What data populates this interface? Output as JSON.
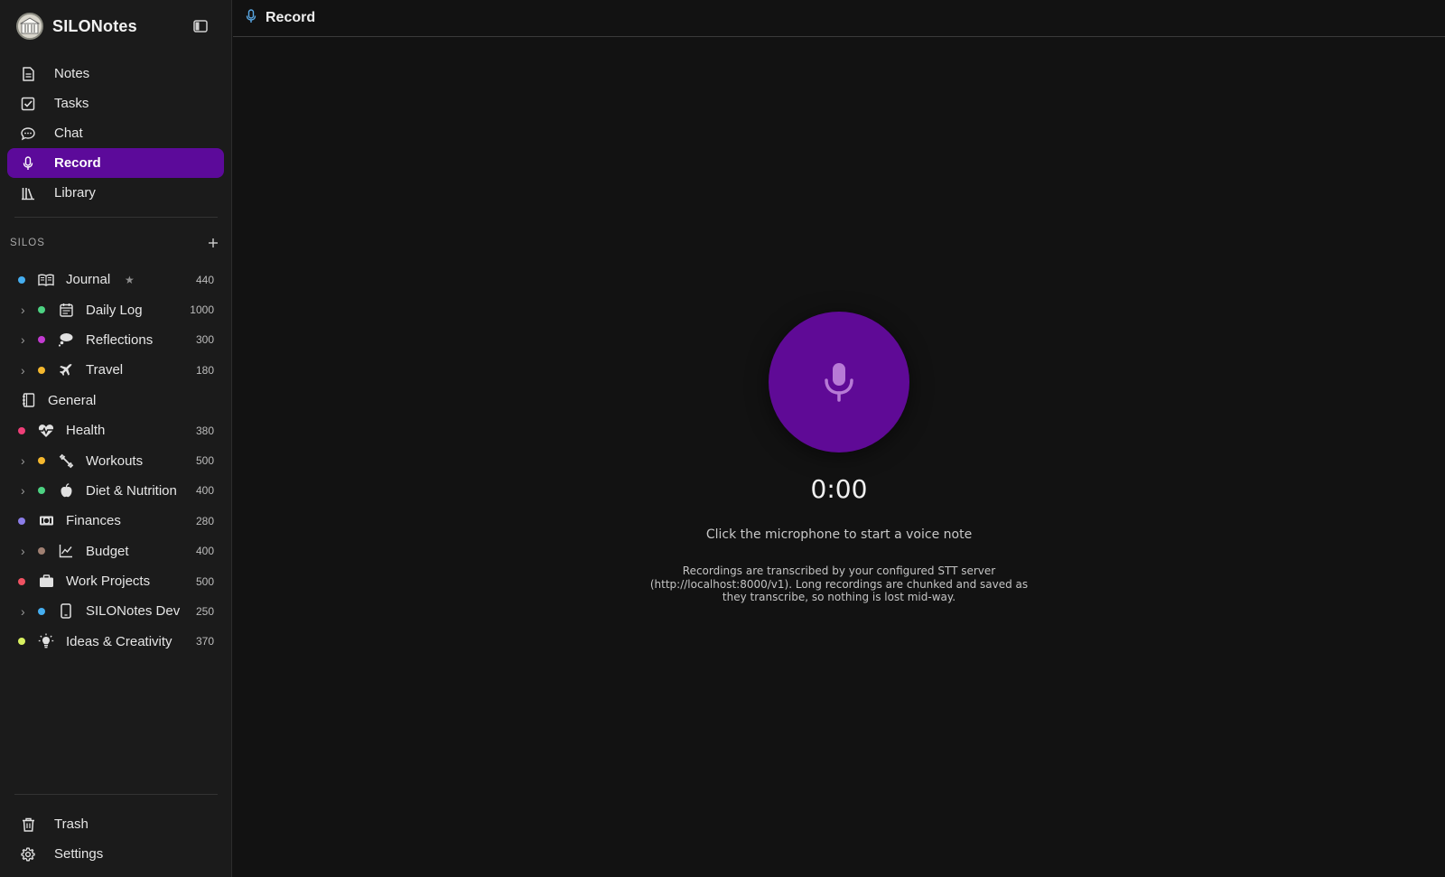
{
  "app": {
    "name": "SILONotes"
  },
  "nav": [
    {
      "label": "Notes",
      "icon": "note-icon"
    },
    {
      "label": "Tasks",
      "icon": "checkbox-icon"
    },
    {
      "label": "Chat",
      "icon": "chat-bubble-icon"
    },
    {
      "label": "Record",
      "icon": "microphone-icon",
      "active": true
    },
    {
      "label": "Library",
      "icon": "books-icon"
    }
  ],
  "silos": {
    "title": "SILOS",
    "items": [
      {
        "name": "Journal",
        "count": "440",
        "dot": "#45aef0",
        "icon": "book-open-icon",
        "starred": true
      },
      {
        "name": "Daily Log",
        "count": "1000",
        "dot": "#4cd282",
        "icon": "calendar-icon"
      },
      {
        "name": "Reflections",
        "count": "300",
        "dot": "#c23ad0",
        "icon": "thought-bubble-icon"
      },
      {
        "name": "Travel",
        "count": "180",
        "dot": "#f5b82e",
        "icon": "airplane-icon"
      },
      {
        "name": "General",
        "icon": "notebook-icon"
      },
      {
        "name": "Health",
        "count": "380",
        "dot": "#ee3f78",
        "icon": "heart-pulse-icon"
      },
      {
        "name": "Workouts",
        "count": "500",
        "dot": "#f5b82e",
        "icon": "dumbbell-icon"
      },
      {
        "name": "Diet & Nutrition",
        "count": "400",
        "dot": "#4cd282",
        "icon": "apple-icon"
      },
      {
        "name": "Finances",
        "count": "280",
        "dot": "#8b7de8",
        "icon": "banknote-icon"
      },
      {
        "name": "Budget",
        "count": "400",
        "dot": "#a08072",
        "icon": "line-chart-icon"
      },
      {
        "name": "Work Projects",
        "count": "500",
        "dot": "#ef5262",
        "icon": "briefcase-icon"
      },
      {
        "name": "SILONotes Dev",
        "count": "250",
        "dot": "#45aef0",
        "icon": "phone-icon"
      },
      {
        "name": "Ideas & Creativity",
        "count": "370",
        "dot": "#d8f060",
        "icon": "lightbulb-icon"
      }
    ]
  },
  "bottom_nav": [
    {
      "label": "Trash",
      "icon": "trash-icon"
    },
    {
      "label": "Settings",
      "icon": "gear-icon"
    }
  ],
  "header": {
    "title": "Record"
  },
  "recorder": {
    "timer": "0:00",
    "hint": "Click the microphone to start a voice note",
    "note": "Recordings are transcribed by your configured STT server (http://localhost:8000/v1). Long recordings are chunked and saved as they transcribe, so nothing is lost mid-way."
  },
  "colors": {
    "accent": "#5f0a96",
    "header_mic": "#5aa9e6"
  }
}
